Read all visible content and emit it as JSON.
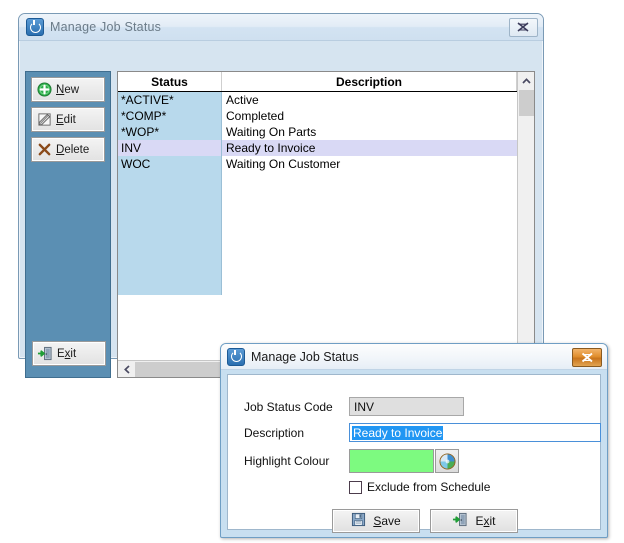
{
  "main_window": {
    "title": "Manage Job Status",
    "icon": "power-app-icon",
    "close_button": "close-icon",
    "toolbar": [
      {
        "label": "New",
        "accel": "N",
        "icon": "green-plus-icon"
      },
      {
        "label": "Edit",
        "accel": "E",
        "icon": "pencil-notepad-icon"
      },
      {
        "label": "Delete",
        "accel": "D",
        "icon": "brown-x-icon"
      }
    ],
    "exit": {
      "label": "Exit",
      "accel": "x",
      "icon": "door-exit-icon"
    },
    "grid": {
      "columns": [
        "Status",
        "Description"
      ],
      "rows": [
        {
          "status": "*ACTIVE*",
          "description": "Active",
          "selected": false
        },
        {
          "status": "*COMP*",
          "description": "Completed",
          "selected": false
        },
        {
          "status": "*WOP*",
          "description": "Waiting On Parts",
          "selected": false
        },
        {
          "status": "INV",
          "description": "Ready to Invoice",
          "selected": true
        },
        {
          "status": "WOC",
          "description": "Waiting On Customer",
          "selected": false
        }
      ]
    }
  },
  "dialog": {
    "title": "Manage Job Status",
    "icon": "power-app-icon",
    "close_button": "close-icon",
    "fields": {
      "code_label": "Job Status Code",
      "code_value": "INV",
      "description_label": "Description",
      "description_value": "Ready to Invoice",
      "colour_label": "Highlight Colour",
      "colour_value": "#7DFA80",
      "colour_picker_icon": "colour-palette-icon",
      "exclude_label": "Exclude from Schedule",
      "exclude_checked": false
    },
    "buttons": [
      {
        "label": "Save",
        "accel": "S",
        "icon": "floppy-save-icon"
      },
      {
        "label": "Exit",
        "accel": "x",
        "icon": "door-exit-icon"
      }
    ]
  },
  "colors": {
    "sidebar": "#5B8FB3",
    "status_column": "#B8D9EC",
    "selected_row": "#D9D9F5",
    "highlight_colour": "#7DFA80",
    "selection_blue": "#2196F3"
  }
}
